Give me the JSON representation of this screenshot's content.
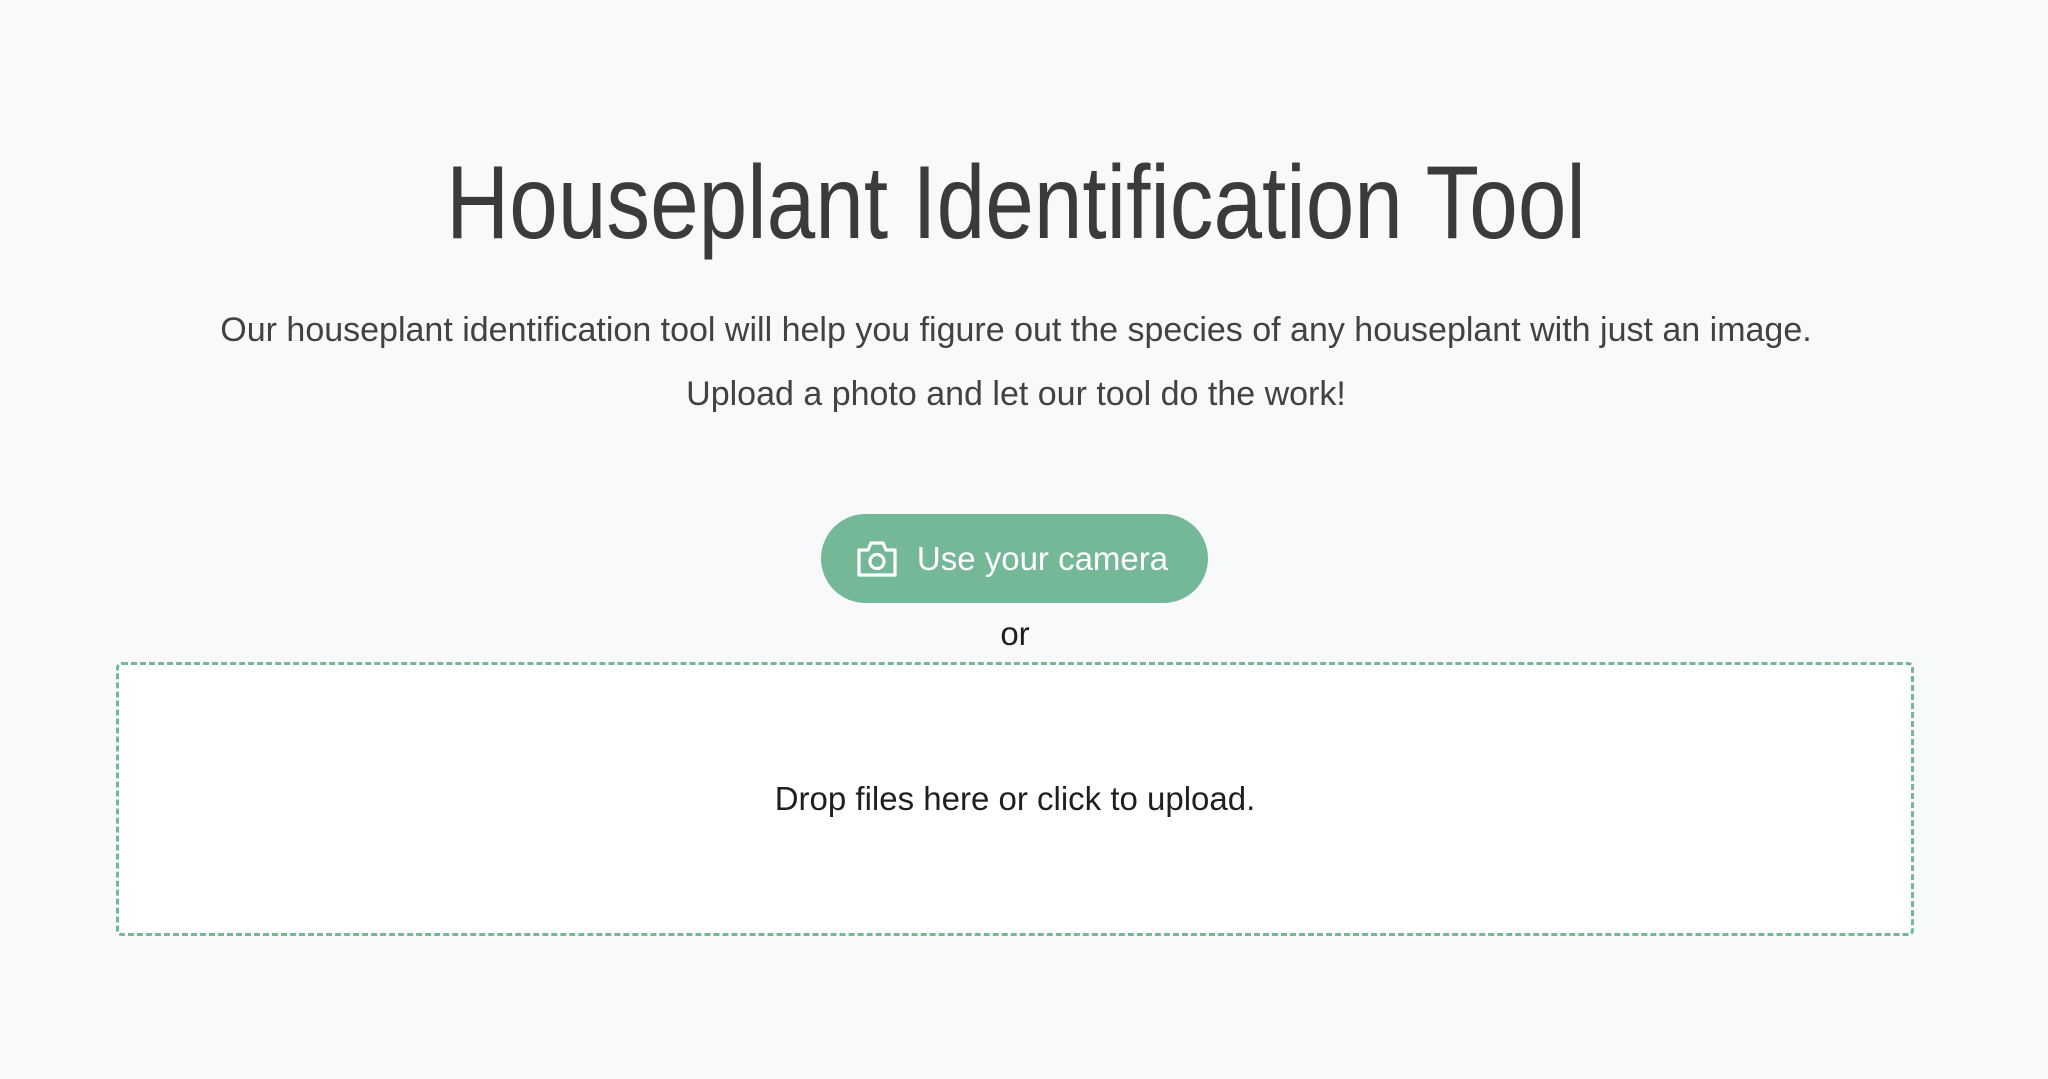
{
  "header": {
    "title": "Houseplant Identification Tool",
    "intro_line_1": "Our houseplant identification tool will help you figure out the species of any houseplant with just an image.",
    "intro_line_2": "Upload a photo and let our tool do the work!"
  },
  "actions": {
    "camera_button_label": "Use your camera",
    "camera_icon": "camera-icon",
    "separator": "or",
    "dropzone_text": "Drop files here or click to upload."
  },
  "colors": {
    "accent": "#74b898",
    "background": "#f8f9fb",
    "text": "#3a3b3c"
  }
}
